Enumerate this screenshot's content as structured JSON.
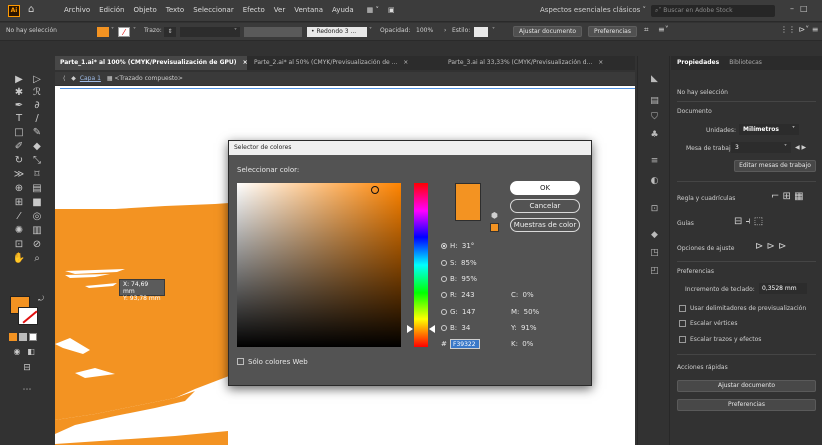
{
  "app": {
    "logo": "Ai",
    "menus": [
      "Archivo",
      "Edición",
      "Objeto",
      "Texto",
      "Seleccionar",
      "Efecto",
      "Ver",
      "Ventana",
      "Ayuda"
    ],
    "workspace": "Aspectos esenciales clásicos",
    "stock_search_placeholder": "Buscar en Adobe Stock"
  },
  "control_bar": {
    "selection_status": "No hay selección",
    "stroke_label": "Trazo:",
    "brush": "Redondo 3 ...",
    "opacity_label": "Opacidad:",
    "opacity_value": "100%",
    "style_label": "Estilo:",
    "adjust_doc": "Ajustar documento",
    "preferences": "Preferencias",
    "fill_color": "#f39322"
  },
  "tabs": [
    {
      "label": "Parte_1.ai* al 100% (CMYK/Previsualización de GPU)",
      "active": true
    },
    {
      "label": "Parte_2.ai* al 50% (CMYK/Previsualización de ...",
      "active": false
    },
    {
      "label": "Parte_3.ai al 33,33% (CMYK/Previsualización d...",
      "active": false
    }
  ],
  "breadcrumb": {
    "layer": "Capa 1",
    "item": "<Trazado compuesto>"
  },
  "coords_tooltip": {
    "x": "X: 74,69 mm",
    "y": "Y: 93,78 mm"
  },
  "dialog": {
    "title": "Selector de colores",
    "select_label": "Seleccionar color:",
    "ok": "OK",
    "cancel": "Cancelar",
    "swatches": "Muestras de color",
    "hsb": [
      {
        "key": "H:",
        "value": "31°",
        "selected": true
      },
      {
        "key": "S:",
        "value": "85%",
        "selected": false
      },
      {
        "key": "B:",
        "value": "95%",
        "selected": false
      }
    ],
    "rgb": [
      {
        "key": "R:",
        "value": "243"
      },
      {
        "key": "G:",
        "value": "147"
      },
      {
        "key": "B:",
        "value": "34"
      }
    ],
    "cmyk": [
      {
        "key": "C:",
        "value": "0%"
      },
      {
        "key": "M:",
        "value": "50%"
      },
      {
        "key": "Y:",
        "value": "91%"
      },
      {
        "key": "K:",
        "value": "0%"
      }
    ],
    "hex_prefix": "#",
    "hex": "F39322",
    "web_only": "Sólo colores Web",
    "color": "#f39322"
  },
  "properties": {
    "tab_properties": "Propiedades",
    "tab_libraries": "Bibliotecas",
    "no_selection": "No hay selección",
    "document": "Documento",
    "units_label": "Unidades:",
    "units_value": "Milímetros",
    "artboard_label": "Mesa de trabajo:",
    "artboard_value": "3",
    "edit_artboards": "Editar mesas de trabajo",
    "rulers_grids": "Regla y cuadrículas",
    "guides": "Guías",
    "snap_options": "Opciones de ajuste",
    "preferences_title": "Preferencias",
    "keyboard_increment_label": "Incremento de teclado:",
    "keyboard_increment_value": "0,3528 mm",
    "checkboxes": [
      "Usar delimitadores de previsualización",
      "Escalar vértices",
      "Escalar trazos y efectos"
    ],
    "quick_actions": "Acciones rápidas",
    "adjust_doc": "Ajustar documento",
    "preferences_btn": "Preferencias"
  },
  "colors": {
    "accent_orange": "#f39322"
  }
}
